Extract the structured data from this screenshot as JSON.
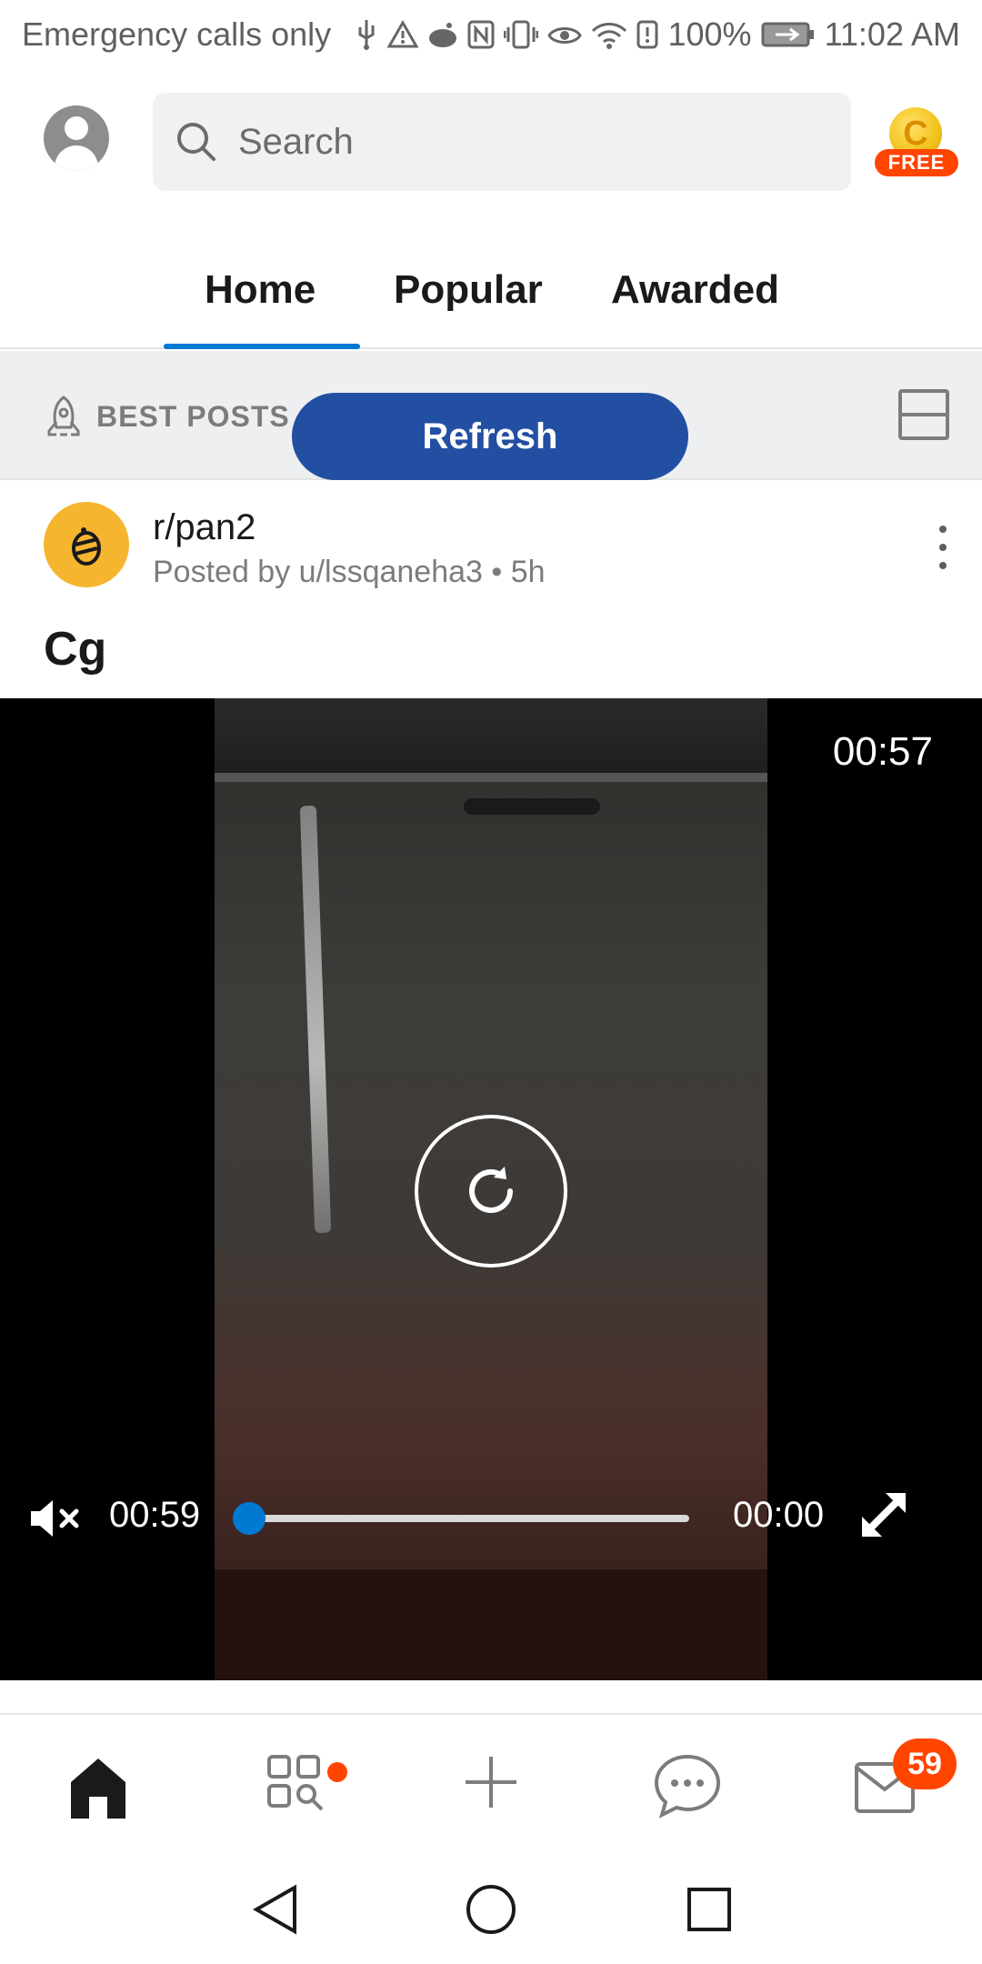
{
  "status_bar": {
    "carrier": "Emergency calls only",
    "battery": "100%",
    "time": "11:02 AM"
  },
  "header": {
    "search_placeholder": "Search",
    "coins_label": "FREE",
    "coin_letter": "C"
  },
  "tabs": [
    {
      "label": "Home",
      "active": true
    },
    {
      "label": "Popular",
      "active": false
    },
    {
      "label": "Awarded",
      "active": false
    }
  ],
  "sort": {
    "label": "BEST POSTS",
    "refresh_label": "Refresh"
  },
  "post": {
    "subreddit": "r/pan2",
    "posted_by": "Posted by u/lssqaneha3 • 5h",
    "title": "Cg",
    "video": {
      "remaining_time": "00:57",
      "current_time": "00:59",
      "end_time": "00:00",
      "progress_fraction": 0.0,
      "muted": true
    }
  },
  "bottom_nav": {
    "inbox_badge": "59"
  },
  "colors": {
    "accent_blue": "#0079d3",
    "refresh_bg": "#234fa3",
    "reddit_orange": "#ff4500",
    "subreddit_icon_bg": "#f5b52e"
  }
}
